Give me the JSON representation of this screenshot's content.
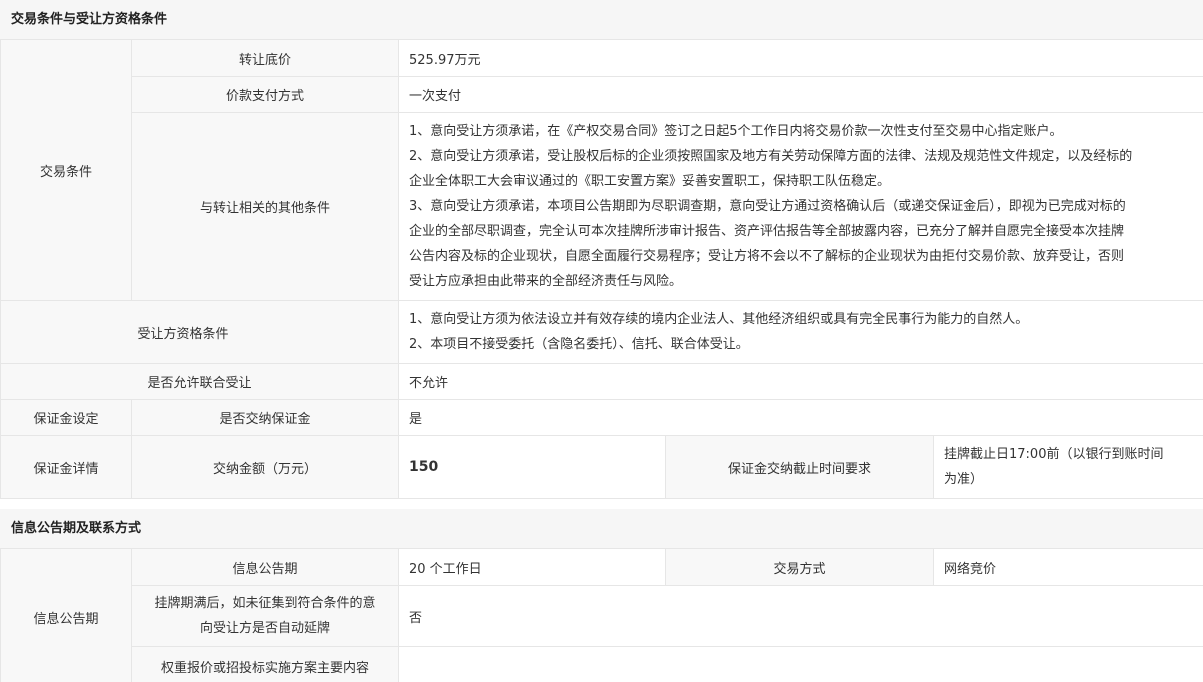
{
  "section1": {
    "title": "交易条件与受让方资格条件",
    "trade_conditions_label": "交易条件",
    "transfer_price_label": "转让底价",
    "transfer_price_value": "525.97万元",
    "payment_method_label": "价款支付方式",
    "payment_method_value": "一次支付",
    "other_conditions_label": "与转让相关的其他条件",
    "other_conditions_lines": [
      "1、意向受让方须承诺，在《产权交易合同》签订之日起5个工作日内将交易价款一次性支付至交易中心指定账户。",
      "2、意向受让方须承诺，受让股权后标的企业须按照国家及地方有关劳动保障方面的法律、法规及规范性文件规定，以及经标的",
      "企业全体职工大会审议通过的《职工安置方案》妥善安置职工，保持职工队伍稳定。",
      "3、意向受让方须承诺，本项目公告期即为尽职调查期，意向受让方通过资格确认后（或递交保证金后），即视为已完成对标的",
      "企业的全部尽职调查，完全认可本次挂牌所涉审计报告、资产评估报告等全部披露内容，已充分了解并自愿完全接受本次挂牌",
      "公告内容及标的企业现状，自愿全面履行交易程序；受让方将不会以不了解标的企业现状为由拒付交易价款、放弃受让，否则",
      "受让方应承担由此带来的全部经济责任与风险。"
    ],
    "qualification_label": "受让方资格条件",
    "qualification_lines": [
      "1、意向受让方须为依法设立并有效存续的境内企业法人、其他经济组织或具有完全民事行为能力的自然人。",
      "2、本项目不接受委托（含隐名委托）、信托、联合体受让。"
    ],
    "joint_label": "是否允许联合受让",
    "joint_value": "不允许",
    "deposit_setting_label": "保证金设定",
    "deposit_required_label": "是否交纳保证金",
    "deposit_required_value": "是",
    "deposit_detail_label": "保证金详情",
    "deposit_amount_label": "交纳金额（万元）",
    "deposit_amount_value": "150",
    "deposit_deadline_label": "保证金交纳截止时间要求",
    "deposit_deadline_lines": [
      "挂牌截止日17:00前（以银行到账时间",
      "为准）"
    ]
  },
  "section2": {
    "title": "信息公告期及联系方式",
    "notice_group_label": "信息公告期",
    "notice_period_label": "信息公告期",
    "notice_period_value": "20 个工作日",
    "trade_method_label": "交易方式",
    "trade_method_value": "网络竞价",
    "auto_extend_label_lines": [
      "挂牌期满后，如未征集到符合条件的意",
      "向受让方是否自动延牌"
    ],
    "auto_extend_value": "否",
    "weighted_label": "权重报价或招投标实施方案主要内容",
    "weighted_value": ""
  }
}
